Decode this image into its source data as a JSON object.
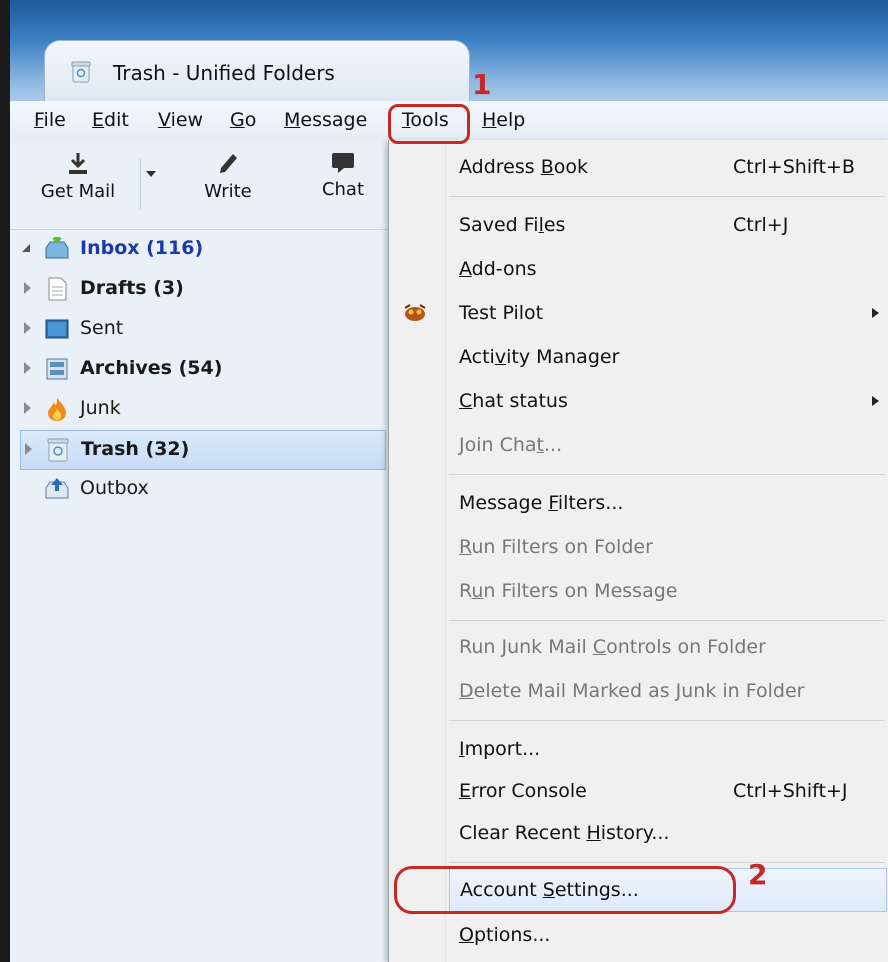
{
  "window": {
    "tab_title": "Trash - Unified Folders"
  },
  "menubar": {
    "file": {
      "accel": "F",
      "rest": "ile"
    },
    "edit": {
      "accel": "E",
      "rest": "dit"
    },
    "view": {
      "accel": "V",
      "rest": "iew"
    },
    "go": {
      "accel": "G",
      "rest": "o"
    },
    "message": {
      "accel": "M",
      "rest": "essage"
    },
    "tools": {
      "accel": "T",
      "rest": "ools"
    },
    "help": {
      "accel": "H",
      "rest": "elp"
    }
  },
  "toolbar": {
    "get_mail": "Get Mail",
    "write": "Write",
    "chat": "Chat"
  },
  "folders": [
    {
      "name": "Inbox (116)",
      "style": "inbox"
    },
    {
      "name": "Drafts (3)",
      "style": "bold"
    },
    {
      "name": "Sent",
      "style": "normal"
    },
    {
      "name": "Archives (54)",
      "style": "bold"
    },
    {
      "name": "Junk",
      "style": "normal"
    },
    {
      "name": "Trash (32)",
      "style": "bold",
      "selected": true
    },
    {
      "name": "Outbox",
      "style": "normal"
    }
  ],
  "tools_menu": {
    "address_book": {
      "pre": "Address ",
      "accel": "B",
      "post": "ook",
      "shortcut": "Ctrl+Shift+B"
    },
    "saved_files": {
      "pre": "Saved Fi",
      "accel": "l",
      "post": "es",
      "shortcut": "Ctrl+J"
    },
    "addons": {
      "pre": "",
      "accel": "A",
      "post": "dd-ons"
    },
    "test_pilot": {
      "pre": "Test Pilot",
      "accel": "",
      "post": ""
    },
    "activity_manager": {
      "pre": "Acti",
      "accel": "v",
      "post": "ity Manager"
    },
    "chat_status": {
      "pre": "",
      "accel": "C",
      "post": "hat status"
    },
    "join_chat": {
      "pre": "Join Cha",
      "accel": "t",
      "post": "..."
    },
    "message_filters": {
      "pre": "Message ",
      "accel": "F",
      "post": "ilters..."
    },
    "run_filters_folder": {
      "pre": "",
      "accel": "R",
      "post": "un Filters on Folder"
    },
    "run_filters_message": {
      "pre": "R",
      "accel": "u",
      "post": "n Filters on Message"
    },
    "run_junk_controls": {
      "pre": "Run Junk Mail ",
      "accel": "C",
      "post": "ontrols on Folder"
    },
    "delete_junk": {
      "pre": "",
      "accel": "D",
      "post": "elete Mail Marked as Junk in Folder"
    },
    "import": {
      "pre": "",
      "accel": "I",
      "post": "mport..."
    },
    "error_console": {
      "pre": "",
      "accel": "E",
      "post": "rror Console",
      "shortcut": "Ctrl+Shift+J"
    },
    "clear_history": {
      "pre": "Clear Recent ",
      "accel": "H",
      "post": "istory..."
    },
    "account_settings": {
      "pre": "Account ",
      "accel": "S",
      "post": "ettings..."
    },
    "options": {
      "pre": "",
      "accel": "O",
      "post": "ptions..."
    }
  },
  "annotations": {
    "step1": "1",
    "step2": "2",
    "color": "#c62828"
  },
  "colors": {
    "menu_bg": "#f0f0f0",
    "pane_bg": "#eaf0f8",
    "inbox_text": "#1a3aa8",
    "selected_bg": "#c5dbf5"
  },
  "icons": {
    "tab": "trash-icon",
    "get_mail": "download-icon",
    "write": "pencil-icon",
    "chat": "chat-bubble-icon",
    "test_pilot": "test-pilot-icon"
  }
}
